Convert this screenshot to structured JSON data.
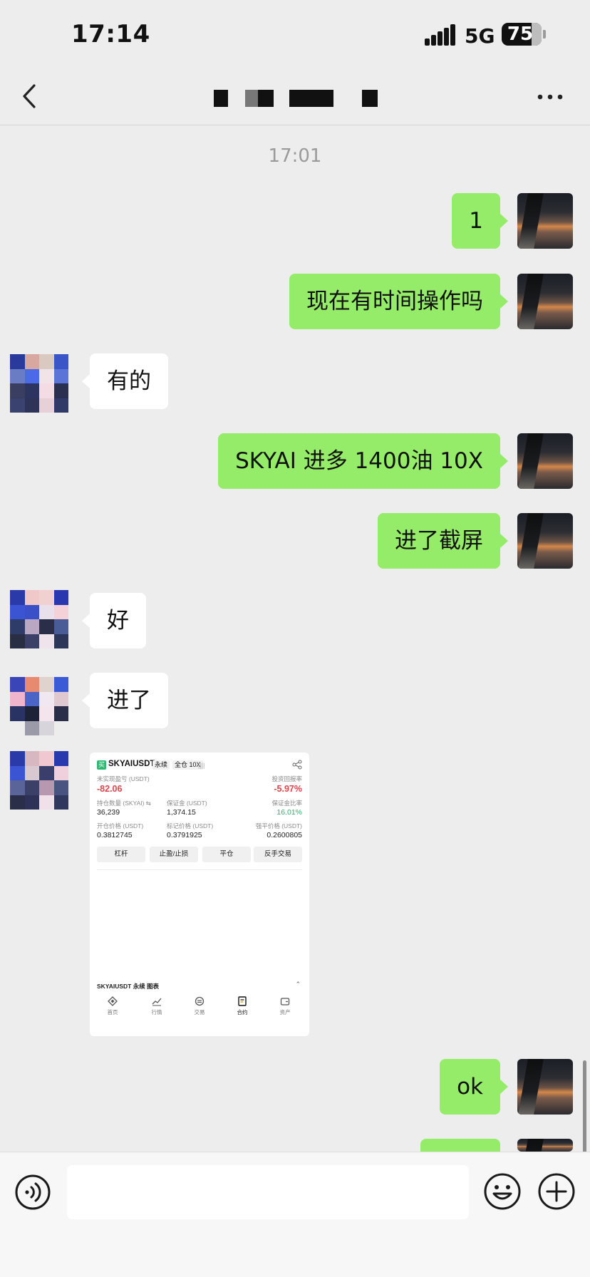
{
  "status_bar": {
    "time": "17:14",
    "network": "5G",
    "battery": "75",
    "battery_level": 0.75
  },
  "nav": {
    "title_redacted": true
  },
  "chat": {
    "timestamp": "17:01",
    "messages": [
      {
        "from": "self",
        "text": "1"
      },
      {
        "from": "self",
        "text": "现在有时间操作吗"
      },
      {
        "from": "other",
        "text": "有的"
      },
      {
        "from": "self",
        "text": "SKYAI 进多 1400油 10X"
      },
      {
        "from": "self",
        "text": "进了截屏"
      },
      {
        "from": "other",
        "text": "好"
      },
      {
        "from": "other",
        "text": "进了"
      },
      {
        "from": "other",
        "type": "image"
      },
      {
        "from": "self",
        "text": "ok"
      },
      {
        "from": "self",
        "text": ""
      }
    ]
  },
  "shared_screenshot": {
    "logo": "买",
    "symbol": "SKYAIUSDT",
    "tags": [
      "永续",
      "全仓 10X"
    ],
    "bars": "||||",
    "unrealized_pnl_label": "未实现盈亏 (USDT)",
    "unrealized_pnl": "-82.06",
    "roi_label": "投资回报率",
    "roi": "-5.97%",
    "position_label": "持仓数量 (SKYAI) ⇆",
    "position": "36,239",
    "margin_label": "保证金 (USDT)",
    "margin": "1,374.15",
    "margin_ratio_label": "保证金比率",
    "margin_ratio": "16.01%",
    "entry_label": "开仓价格 (USDT)",
    "entry": "0.3812745",
    "mark_label": "标记价格 (USDT)",
    "mark": "0.3791925",
    "liq_label": "强平价格 (USDT)",
    "liq": "0.2600805",
    "buttons": [
      "杠杆",
      "止盈/止损",
      "平仓",
      "反手交易"
    ],
    "chart_label": "SKYAIUSDT 永续 图表",
    "chart_caret": "⌃",
    "tabs": [
      "首页",
      "行情",
      "交易",
      "合约",
      "资产"
    ]
  },
  "input_bar": {
    "placeholder": ""
  },
  "colors": {
    "bubble_out": "#95ec69",
    "bubble_in": "#ffffff",
    "background": "#ededed"
  }
}
